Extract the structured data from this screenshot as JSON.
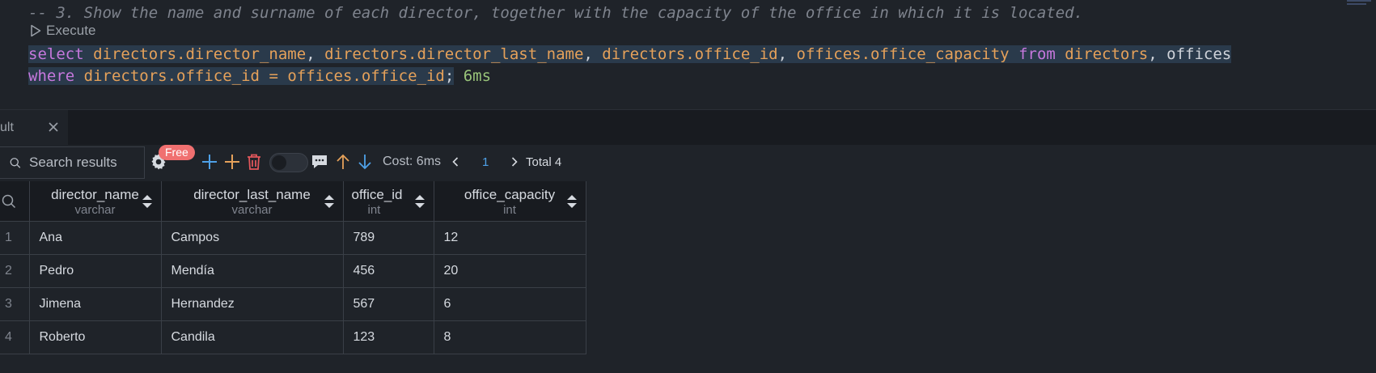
{
  "editor": {
    "comment": "-- 3. Show the name and surname of each director, together with the capacity of the office in which it is located.",
    "execute_label": "Execute",
    "line1": {
      "select": "select",
      "c1": "directors.director_name",
      "c2": "directors.director_last_name",
      "c3": "directors.office_id",
      "c4": "offices.office_capacity",
      "from": "from",
      "t1": "directors",
      "t2": "offices"
    },
    "line2": {
      "where": "where",
      "left": "directors.office_id",
      "eq": "=",
      "right": "offices.office_id",
      "semi": ";",
      "timing": "6ms"
    }
  },
  "result_tab": {
    "label": "ult"
  },
  "toolbar": {
    "search_placeholder": "Search results",
    "badge": "Free",
    "cost": "Cost: 6ms",
    "page": "1",
    "total": "Total 4"
  },
  "table": {
    "columns": [
      {
        "name": "director_name",
        "type": "varchar"
      },
      {
        "name": "director_last_name",
        "type": "varchar"
      },
      {
        "name": "office_id",
        "type": "int"
      },
      {
        "name": "office_capacity",
        "type": "int"
      }
    ],
    "rows": [
      {
        "n": "1",
        "cells": [
          "Ana",
          "Campos",
          "789",
          "12"
        ]
      },
      {
        "n": "2",
        "cells": [
          "Pedro",
          "Mendía",
          "456",
          "20"
        ]
      },
      {
        "n": "3",
        "cells": [
          "Jimena",
          "Hernandez",
          "567",
          "6"
        ]
      },
      {
        "n": "4",
        "cells": [
          "Roberto",
          "Candila",
          "123",
          "8"
        ]
      }
    ]
  },
  "colors": {
    "keyword": "#c678dd",
    "identifier": "#e5a15a",
    "timing": "#98c379",
    "add": "#4ea1e8",
    "delete": "#e0565b",
    "badge": "#f07070"
  },
  "icons": [
    "play-icon",
    "close-icon",
    "search-icon",
    "gear-icon",
    "plus-icon",
    "delete-icon",
    "comment-icon",
    "arrow-up-icon",
    "arrow-down-icon",
    "chevron-left-icon",
    "chevron-right-icon",
    "sort-icon"
  ]
}
